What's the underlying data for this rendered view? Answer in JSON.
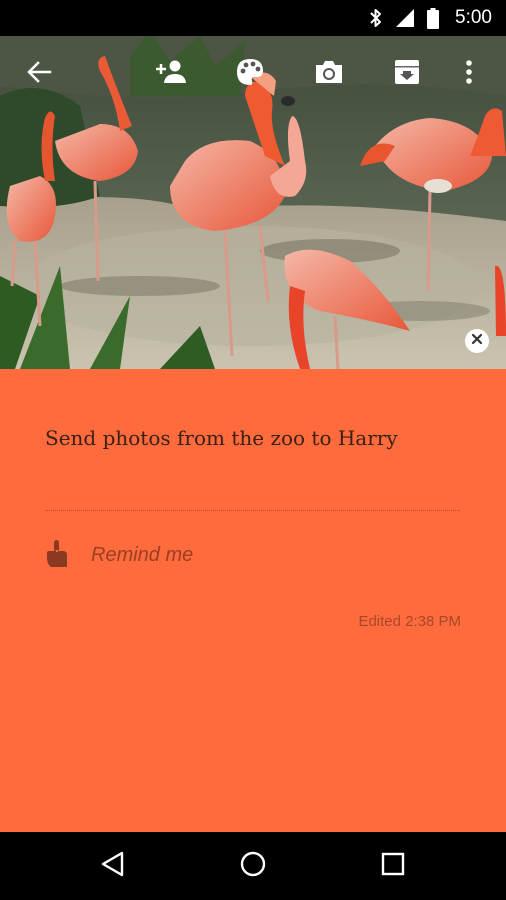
{
  "status_bar": {
    "time": "5:00",
    "icons": [
      "bluetooth-icon",
      "signal-icon",
      "battery-icon"
    ]
  },
  "toolbar": {
    "icons": [
      "back-arrow-icon",
      "add-collaborator-icon",
      "palette-icon",
      "camera-icon",
      "archive-icon",
      "more-vert-icon"
    ]
  },
  "note": {
    "title": "Send photos from the zoo to Harry",
    "reminder_label": "Remind me",
    "edited_text": "Edited 2:38 PM",
    "color": "#ff6b3d"
  },
  "nav_bar": {
    "icons": [
      "back-triangle-icon",
      "home-circle-icon",
      "recents-square-icon"
    ]
  }
}
